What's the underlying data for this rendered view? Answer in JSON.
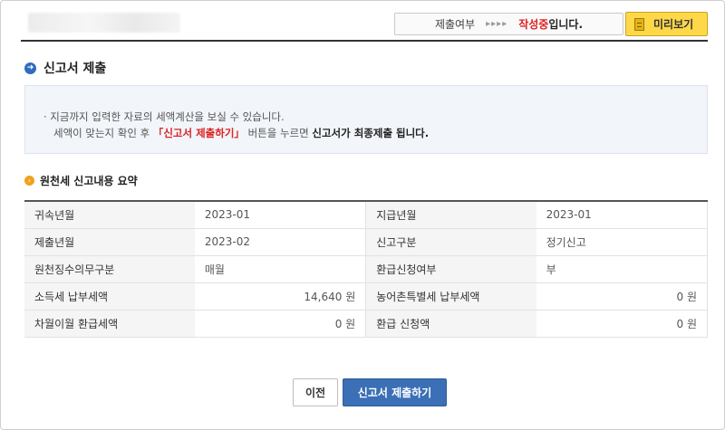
{
  "header": {
    "status_label": "제출여부",
    "status_arrows": "▸▸▸▸",
    "status_value": "작성중",
    "status_suffix": "입니다.",
    "preview_label": "미리보기"
  },
  "section": {
    "title": "신고서 제출"
  },
  "info": {
    "line1": "· 지금까지 입력한 자료의 세액계산을 보실 수 있습니다.",
    "line2_prefix": "세액이 맞는지 확인 후 ",
    "line2_red": "「신고서 제출하기」",
    "line2_mid": " 버튼을 누르면 ",
    "line2_bold": "신고서가 최종제출 됩니다."
  },
  "summary": {
    "heading": "원천세 신고내용 요약",
    "rows": [
      {
        "l1": "귀속년월",
        "v1": "2023-01",
        "l2": "지급년월",
        "v2": "2023-01"
      },
      {
        "l1": "제출년월",
        "v1": "2023-02",
        "l2": "신고구분",
        "v2": "정기신고"
      },
      {
        "l1": "원천징수의무구분",
        "v1": "매월",
        "l2": "환급신청여부",
        "v2": "부"
      },
      {
        "l1": "소득세 납부세액",
        "v1": "14,640 원",
        "l2": "농어촌특별세 납부세액",
        "v2": "0 원"
      },
      {
        "l1": "차월이월 환급세액",
        "v1": "0 원",
        "l2": "환급 신청액",
        "v2": "0 원"
      }
    ]
  },
  "buttons": {
    "prev": "이전",
    "submit": "신고서 제출하기"
  },
  "colors": {
    "accent_blue": "#3b6fb6",
    "status_red": "#dd2222",
    "preview_yellow": "#ffd84a",
    "bullet_orange": "#f0a21b"
  }
}
